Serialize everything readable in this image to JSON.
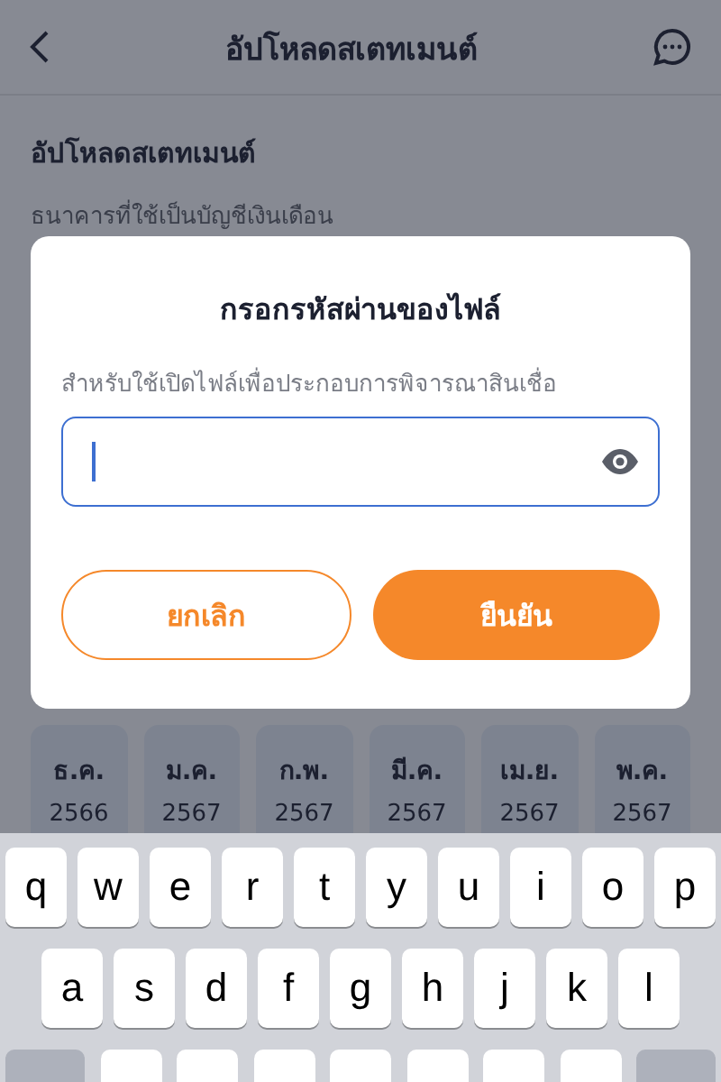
{
  "header": {
    "title": "อัปโหลดสเตทเมนต์"
  },
  "page": {
    "heading": "อัปโหลดสเตทเมนต์",
    "bank_label": "ธนาคารที่ใช้เป็นบัญชีเงินเดือน",
    "months": [
      {
        "month": "ธ.ค.",
        "year": "2566"
      },
      {
        "month": "ม.ค.",
        "year": "2567"
      },
      {
        "month": "ก.พ.",
        "year": "2567"
      },
      {
        "month": "มี.ค.",
        "year": "2567"
      },
      {
        "month": "เม.ย.",
        "year": "2567"
      },
      {
        "month": "พ.ค.",
        "year": "2567"
      }
    ]
  },
  "dialog": {
    "title": "กรอกรหัสผ่านของไฟล์",
    "subtitle": "สำหรับใช้เปิดไฟล์เพื่อประกอบการพิจารณาสินเชื่อ",
    "cancel": "ยกเลิก",
    "confirm": "ยืนยัน"
  },
  "keyboard": {
    "rows": [
      [
        "q",
        "w",
        "e",
        "r",
        "t",
        "y",
        "u",
        "i",
        "o",
        "p"
      ],
      [
        "a",
        "s",
        "d",
        "f",
        "g",
        "h",
        "j",
        "k",
        "l"
      ]
    ]
  }
}
